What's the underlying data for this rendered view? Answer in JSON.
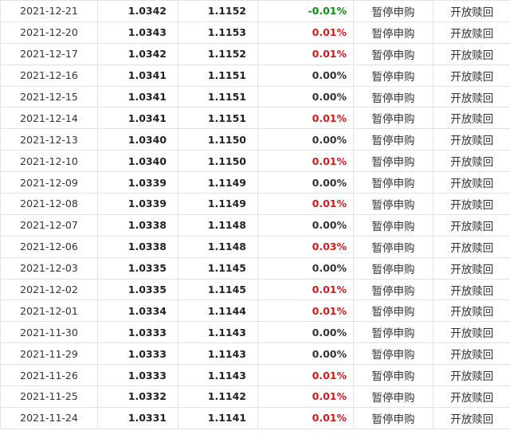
{
  "colors": {
    "up": "#d01b1b",
    "down": "#0e8a16",
    "flat": "#333333",
    "border": "#e2e2e2"
  },
  "rows": [
    {
      "date": "2021-12-21",
      "unit_nav": "1.0342",
      "accum_nav": "1.1152",
      "growth": "-0.01%",
      "trend": "down",
      "subscription": "暂停申购",
      "redemption": "开放赎回"
    },
    {
      "date": "2021-12-20",
      "unit_nav": "1.0343",
      "accum_nav": "1.1153",
      "growth": "0.01%",
      "trend": "up",
      "subscription": "暂停申购",
      "redemption": "开放赎回"
    },
    {
      "date": "2021-12-17",
      "unit_nav": "1.0342",
      "accum_nav": "1.1152",
      "growth": "0.01%",
      "trend": "up",
      "subscription": "暂停申购",
      "redemption": "开放赎回"
    },
    {
      "date": "2021-12-16",
      "unit_nav": "1.0341",
      "accum_nav": "1.1151",
      "growth": "0.00%",
      "trend": "flat",
      "subscription": "暂停申购",
      "redemption": "开放赎回"
    },
    {
      "date": "2021-12-15",
      "unit_nav": "1.0341",
      "accum_nav": "1.1151",
      "growth": "0.00%",
      "trend": "flat",
      "subscription": "暂停申购",
      "redemption": "开放赎回"
    },
    {
      "date": "2021-12-14",
      "unit_nav": "1.0341",
      "accum_nav": "1.1151",
      "growth": "0.01%",
      "trend": "up",
      "subscription": "暂停申购",
      "redemption": "开放赎回"
    },
    {
      "date": "2021-12-13",
      "unit_nav": "1.0340",
      "accum_nav": "1.1150",
      "growth": "0.00%",
      "trend": "flat",
      "subscription": "暂停申购",
      "redemption": "开放赎回"
    },
    {
      "date": "2021-12-10",
      "unit_nav": "1.0340",
      "accum_nav": "1.1150",
      "growth": "0.01%",
      "trend": "up",
      "subscription": "暂停申购",
      "redemption": "开放赎回"
    },
    {
      "date": "2021-12-09",
      "unit_nav": "1.0339",
      "accum_nav": "1.1149",
      "growth": "0.00%",
      "trend": "flat",
      "subscription": "暂停申购",
      "redemption": "开放赎回"
    },
    {
      "date": "2021-12-08",
      "unit_nav": "1.0339",
      "accum_nav": "1.1149",
      "growth": "0.01%",
      "trend": "up",
      "subscription": "暂停申购",
      "redemption": "开放赎回"
    },
    {
      "date": "2021-12-07",
      "unit_nav": "1.0338",
      "accum_nav": "1.1148",
      "growth": "0.00%",
      "trend": "flat",
      "subscription": "暂停申购",
      "redemption": "开放赎回"
    },
    {
      "date": "2021-12-06",
      "unit_nav": "1.0338",
      "accum_nav": "1.1148",
      "growth": "0.03%",
      "trend": "up",
      "subscription": "暂停申购",
      "redemption": "开放赎回"
    },
    {
      "date": "2021-12-03",
      "unit_nav": "1.0335",
      "accum_nav": "1.1145",
      "growth": "0.00%",
      "trend": "flat",
      "subscription": "暂停申购",
      "redemption": "开放赎回"
    },
    {
      "date": "2021-12-02",
      "unit_nav": "1.0335",
      "accum_nav": "1.1145",
      "growth": "0.01%",
      "trend": "up",
      "subscription": "暂停申购",
      "redemption": "开放赎回"
    },
    {
      "date": "2021-12-01",
      "unit_nav": "1.0334",
      "accum_nav": "1.1144",
      "growth": "0.01%",
      "trend": "up",
      "subscription": "暂停申购",
      "redemption": "开放赎回"
    },
    {
      "date": "2021-11-30",
      "unit_nav": "1.0333",
      "accum_nav": "1.1143",
      "growth": "0.00%",
      "trend": "flat",
      "subscription": "暂停申购",
      "redemption": "开放赎回"
    },
    {
      "date": "2021-11-29",
      "unit_nav": "1.0333",
      "accum_nav": "1.1143",
      "growth": "0.00%",
      "trend": "flat",
      "subscription": "暂停申购",
      "redemption": "开放赎回"
    },
    {
      "date": "2021-11-26",
      "unit_nav": "1.0333",
      "accum_nav": "1.1143",
      "growth": "0.01%",
      "trend": "up",
      "subscription": "暂停申购",
      "redemption": "开放赎回"
    },
    {
      "date": "2021-11-25",
      "unit_nav": "1.0332",
      "accum_nav": "1.1142",
      "growth": "0.01%",
      "trend": "up",
      "subscription": "暂停申购",
      "redemption": "开放赎回"
    },
    {
      "date": "2021-11-24",
      "unit_nav": "1.0331",
      "accum_nav": "1.1141",
      "growth": "0.01%",
      "trend": "up",
      "subscription": "暂停申购",
      "redemption": "开放赎回"
    }
  ]
}
